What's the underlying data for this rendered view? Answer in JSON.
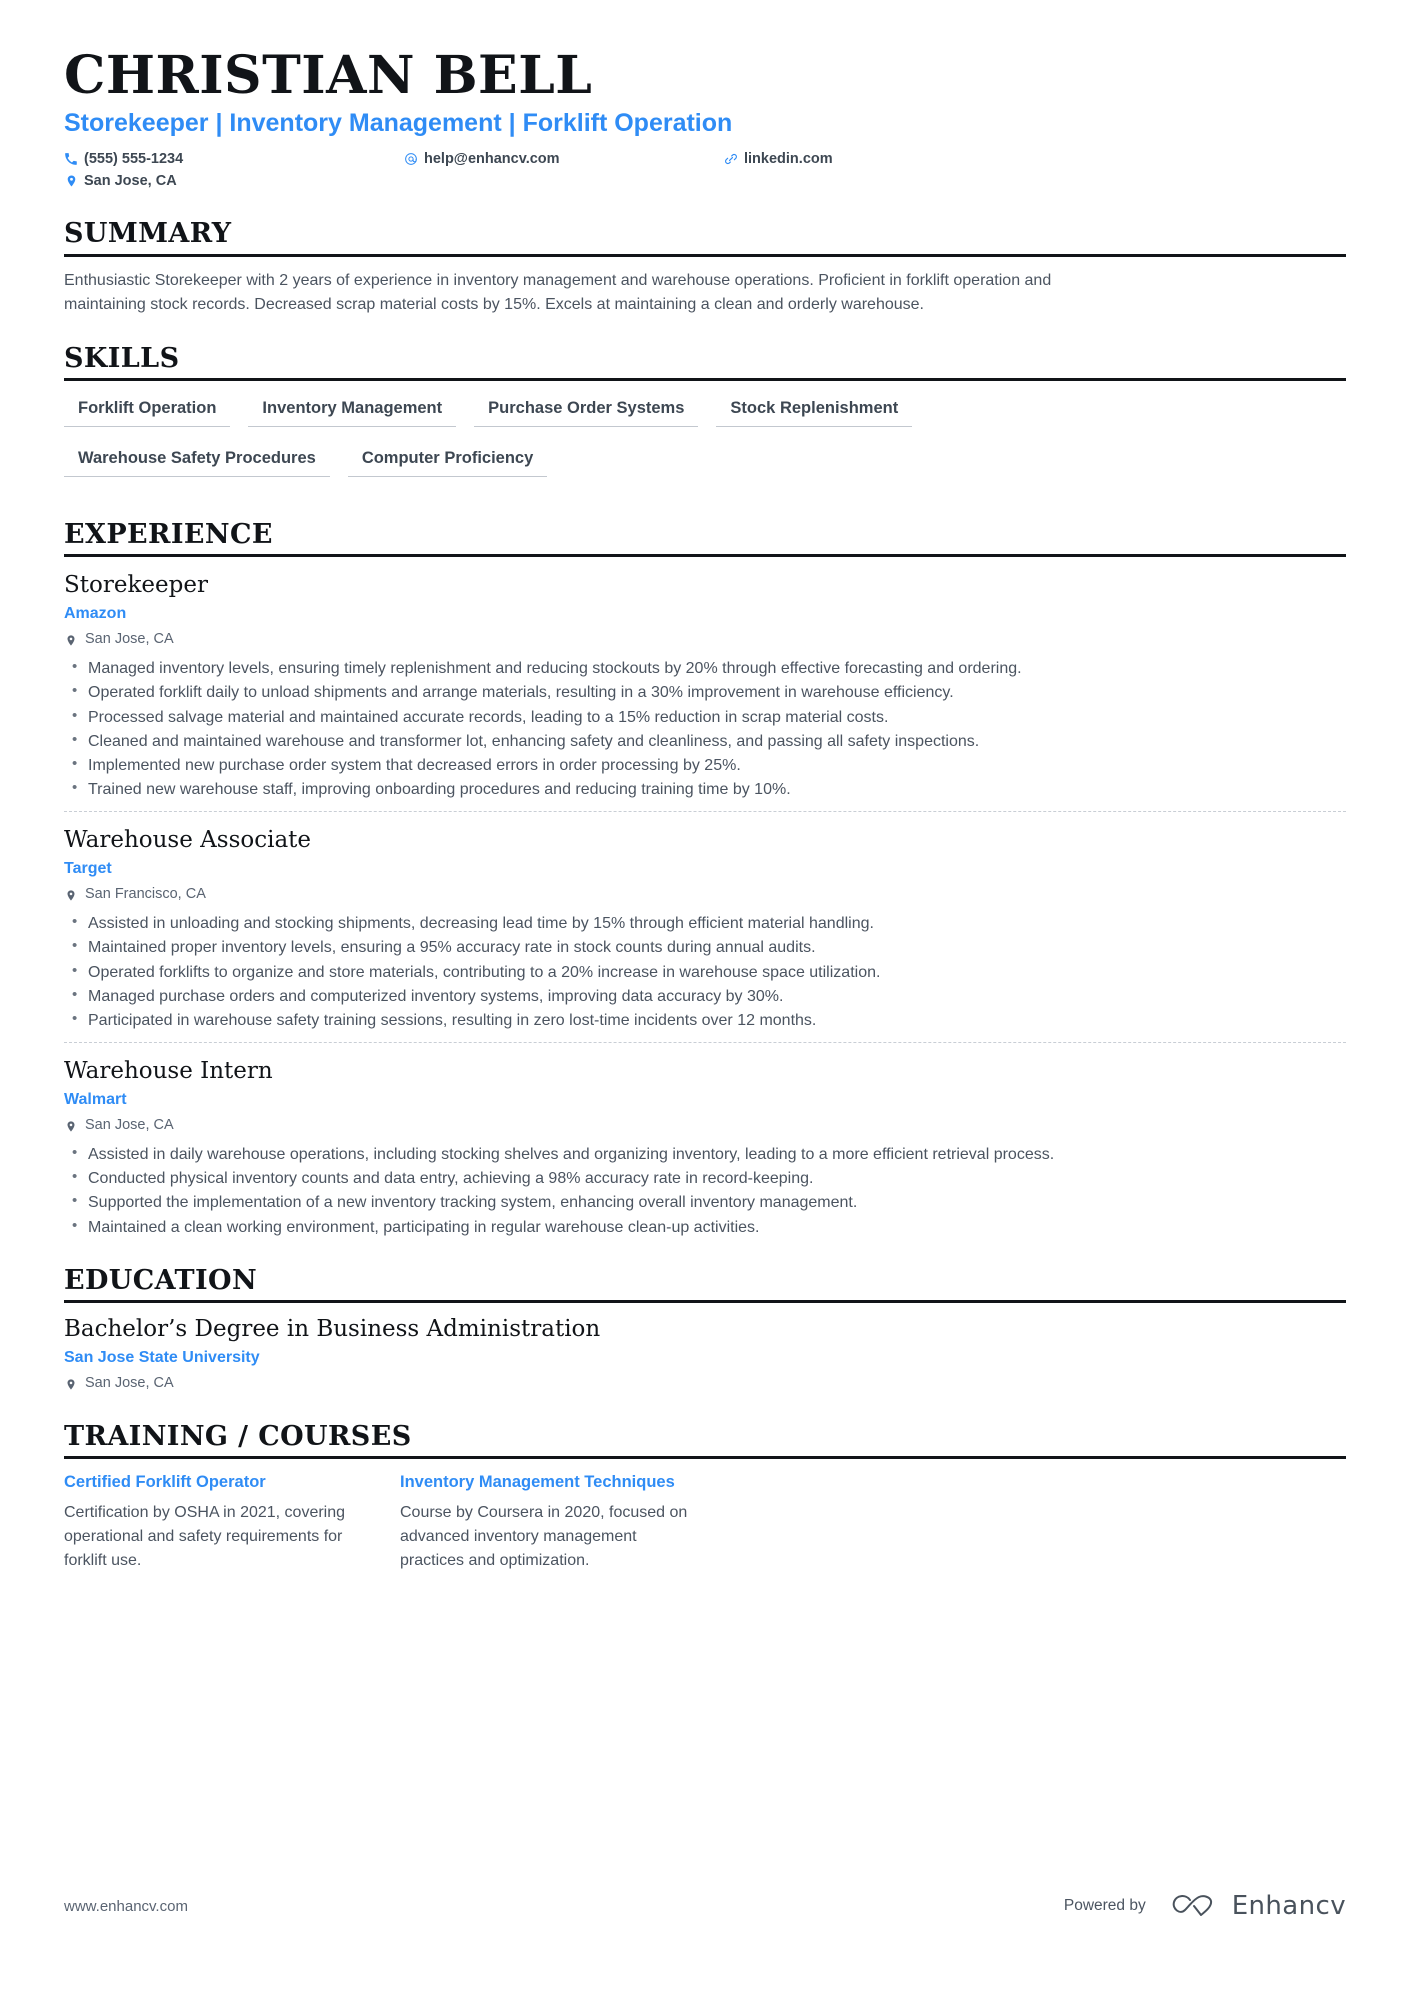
{
  "theme": {
    "accent": "#2f8cf5",
    "text": "#3d4752",
    "heading": "#111418"
  },
  "header": {
    "full_name": "CHRISTIAN BELL",
    "headline": "Storekeeper | Inventory Management | Forklift Operation",
    "contacts": [
      {
        "icon": "phone-icon",
        "value": "(555) 555-1234"
      },
      {
        "icon": "email-icon",
        "value": "help@enhancv.com"
      },
      {
        "icon": "link-icon",
        "value": "linkedin.com"
      },
      {
        "icon": "location-icon",
        "value": "San Jose, CA"
      }
    ]
  },
  "summary": {
    "title": "SUMMARY",
    "text": "Enthusiastic Storekeeper with 2 years of experience in inventory management and warehouse operations. Proficient in forklift operation and maintaining stock records. Decreased scrap material costs by 15%. Excels at maintaining a clean and orderly warehouse."
  },
  "skills": {
    "title": "SKILLS",
    "items": [
      "Forklift Operation",
      "Inventory Management",
      "Purchase Order Systems",
      "Stock Replenishment",
      "Warehouse Safety Procedures",
      "Computer Proficiency"
    ]
  },
  "experience": {
    "title": "EXPERIENCE",
    "jobs": [
      {
        "title": "Storekeeper",
        "company": "Amazon",
        "location": "San Jose, CA",
        "bullets": [
          "Managed inventory levels, ensuring timely replenishment and reducing stockouts by 20% through effective forecasting and ordering.",
          "Operated forklift daily to unload shipments and arrange materials, resulting in a 30% improvement in warehouse efficiency.",
          "Processed salvage material and maintained accurate records, leading to a 15% reduction in scrap material costs.",
          "Cleaned and maintained warehouse and transformer lot, enhancing safety and cleanliness, and passing all safety inspections.",
          "Implemented new purchase order system that decreased errors in order processing by 25%.",
          "Trained new warehouse staff, improving onboarding procedures and reducing training time by 10%."
        ]
      },
      {
        "title": "Warehouse Associate",
        "company": "Target",
        "location": "San Francisco, CA",
        "bullets": [
          "Assisted in unloading and stocking shipments, decreasing lead time by 15% through efficient material handling.",
          "Maintained proper inventory levels, ensuring a 95% accuracy rate in stock counts during annual audits.",
          "Operated forklifts to organize and store materials, contributing to a 20% increase in warehouse space utilization.",
          "Managed purchase orders and computerized inventory systems, improving data accuracy by 30%.",
          "Participated in warehouse safety training sessions, resulting in zero lost-time incidents over 12 months."
        ]
      },
      {
        "title": "Warehouse Intern",
        "company": "Walmart",
        "location": "San Jose, CA",
        "bullets": [
          "Assisted in daily warehouse operations, including stocking shelves and organizing inventory, leading to a more efficient retrieval process.",
          "Conducted physical inventory counts and data entry, achieving a 98% accuracy rate in record-keeping.",
          "Supported the implementation of a new inventory tracking system, enhancing overall inventory management.",
          "Maintained a clean working environment, participating in regular warehouse clean-up activities."
        ]
      }
    ]
  },
  "education": {
    "title": "EDUCATION",
    "entries": [
      {
        "degree": "Bachelor’s Degree in Business Administration",
        "school": "San Jose State University",
        "location": "San Jose, CA"
      }
    ]
  },
  "courses": {
    "title": "TRAINING / COURSES",
    "items": [
      {
        "name": "Certified Forklift Operator",
        "description": "Certification by OSHA in 2021, covering operational and safety requirements for forklift use."
      },
      {
        "name": "Inventory Management Techniques",
        "description": "Course by Coursera in 2020, focused on advanced inventory management practices and optimization."
      }
    ]
  },
  "footer": {
    "url": "www.enhancv.com",
    "powered_by": "Powered by",
    "brand": "Enhancv"
  }
}
